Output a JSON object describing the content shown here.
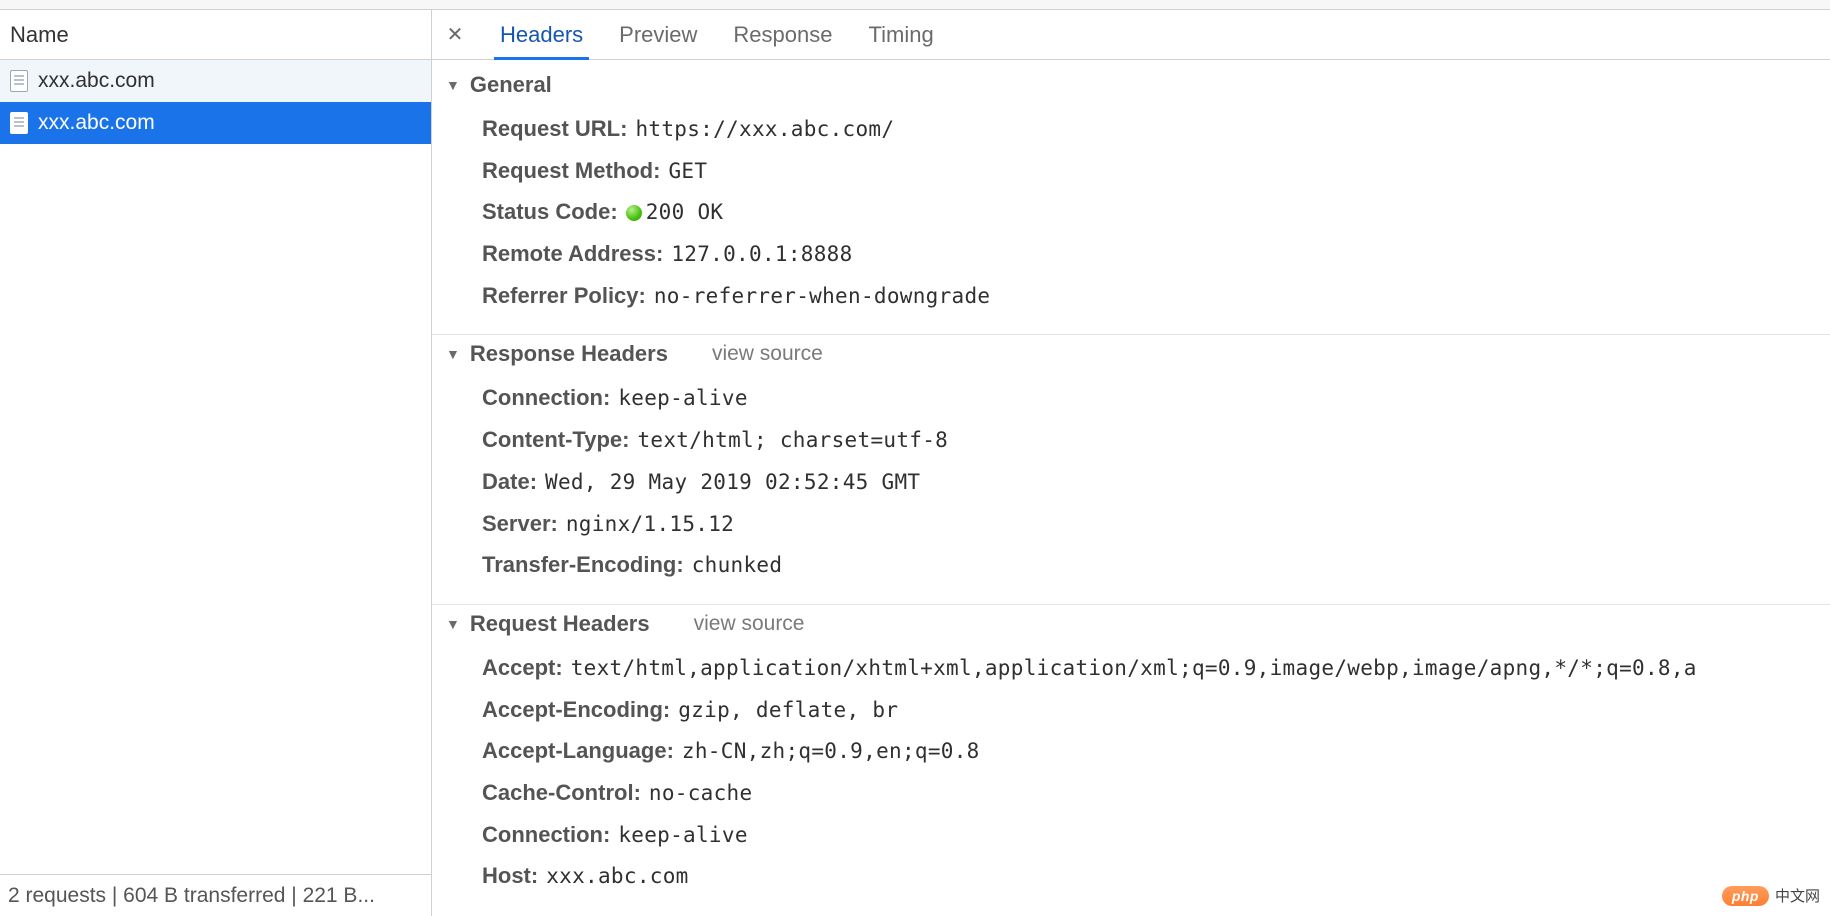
{
  "left": {
    "header": "Name",
    "requests": [
      {
        "name": "xxx.abc.com",
        "selected": false
      },
      {
        "name": "xxx.abc.com",
        "selected": true
      }
    ],
    "footer": "2 requests | 604 B transferred | 221 B..."
  },
  "tabs": {
    "items": [
      {
        "label": "Headers",
        "active": true
      },
      {
        "label": "Preview",
        "active": false
      },
      {
        "label": "Response",
        "active": false
      },
      {
        "label": "Timing",
        "active": false
      }
    ]
  },
  "sections": {
    "general": {
      "title": "General",
      "items": [
        {
          "key": "Request URL",
          "value": "https://xxx.abc.com/"
        },
        {
          "key": "Request Method",
          "value": "GET"
        },
        {
          "key": "Status Code",
          "value": "200 OK",
          "status_dot": true
        },
        {
          "key": "Remote Address",
          "value": "127.0.0.1:8888"
        },
        {
          "key": "Referrer Policy",
          "value": "no-referrer-when-downgrade"
        }
      ]
    },
    "response_headers": {
      "title": "Response Headers",
      "view_source": "view source",
      "items": [
        {
          "key": "Connection",
          "value": "keep-alive"
        },
        {
          "key": "Content-Type",
          "value": "text/html; charset=utf-8"
        },
        {
          "key": "Date",
          "value": "Wed, 29 May 2019 02:52:45 GMT"
        },
        {
          "key": "Server",
          "value": "nginx/1.15.12"
        },
        {
          "key": "Transfer-Encoding",
          "value": "chunked"
        }
      ]
    },
    "request_headers": {
      "title": "Request Headers",
      "view_source": "view source",
      "items": [
        {
          "key": "Accept",
          "value": "text/html,application/xhtml+xml,application/xml;q=0.9,image/webp,image/apng,*/*;q=0.8,a"
        },
        {
          "key": "Accept-Encoding",
          "value": "gzip, deflate, br"
        },
        {
          "key": "Accept-Language",
          "value": "zh-CN,zh;q=0.9,en;q=0.8"
        },
        {
          "key": "Cache-Control",
          "value": "no-cache"
        },
        {
          "key": "Connection",
          "value": "keep-alive"
        },
        {
          "key": "Host",
          "value": "xxx.abc.com"
        }
      ]
    }
  },
  "watermark": {
    "badge": "php",
    "text": "中文网"
  }
}
